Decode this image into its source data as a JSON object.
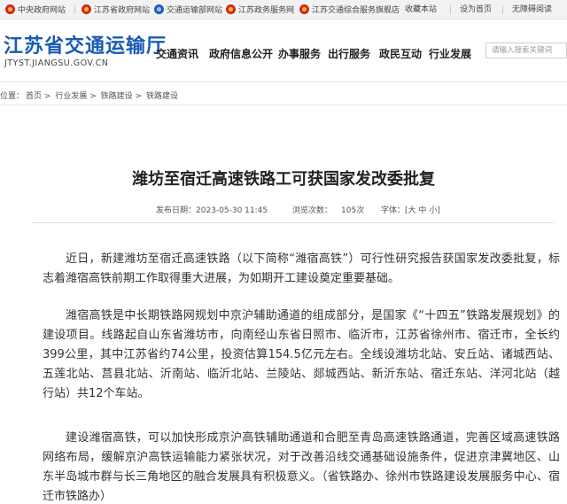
{
  "topbar": {
    "links": [
      {
        "label": "中央政府网站",
        "emblem": "red"
      },
      {
        "label": "江苏省政府网站",
        "emblem": "red"
      },
      {
        "label": "交通运输部网站",
        "emblem": "blue"
      },
      {
        "label": "江苏政务服务网",
        "emblem": "red"
      },
      {
        "label": "江苏交通综合服务旗舰店",
        "emblem": "red"
      }
    ],
    "right": [
      "收藏本站",
      "设为首页",
      "无障碍阅读"
    ]
  },
  "header": {
    "title": "江苏省交通运输厅",
    "url": "JTYST.JIANGSU.GOV.CN",
    "nav": [
      "交通资讯",
      "政府信息公开",
      "办事服务",
      "出行服务",
      "政民互动",
      "行业发展"
    ],
    "search_placeholder": "请输入搜索关键词"
  },
  "breadcrumb": {
    "label": "位置：",
    "items": [
      "首页",
      "行业发展",
      "铁路建设",
      "铁路建设"
    ],
    "separator": ">"
  },
  "article": {
    "title": "潍坊至宿迁高速铁路工可获国家发改委批复",
    "publish_label": "发布日期：",
    "publish_date": "2023-05-30 11:45",
    "views_label": "浏览次数：",
    "views": "105次",
    "font_label": "字体：",
    "font_open": "[",
    "font_sizes": [
      "大",
      "中",
      "小"
    ],
    "font_close": "]",
    "paragraphs": [
      "近日，新建潍坊至宿迁高速铁路（以下简称“潍宿高铁”）可行性研究报告获国家发改委批复，标志着潍宿高铁前期工作取得重大进展，为如期开工建设奠定重要基础。",
      "潍宿高铁是中长期铁路网规划中京沪辅助通道的组成部分，是国家《“十四五”铁路发展规划》的建设项目。线路起自山东省潍坊市，向南经山东省日照市、临沂市，江苏省徐州市、宿迁市，全长约399公里，其中江苏省约74公里，投资估算154.5亿元左右。全线设潍坊北站、安丘站、诸城西站、五莲北站、莒县北站、沂南站、临沂北站、兰陵站、郯城西站、新沂东站、宿迁东站、洋河北站（越行站）共12个车站。",
      "建设潍宿高铁，可以加快形成京沪高铁辅助通道和合肥至青岛高速铁路通道，完善区域高速铁路网络布局，缓解京沪高铁运输能力紧张状况，对于改善沿线交通基础设施条件，促进京津冀地区、山东半岛城市群与长三角地区的融合发展具有积极意义。（省铁路办、徐州市铁路建设发展服务中心、宿迁市铁路办）"
    ]
  }
}
